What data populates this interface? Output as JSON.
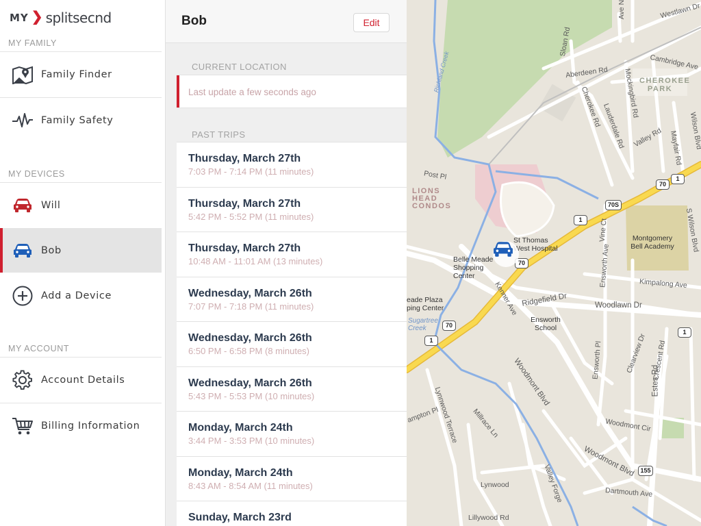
{
  "logo": {
    "my": "MY",
    "brand": "splitsecnd"
  },
  "sidebar": {
    "sections": {
      "family": "MY FAMILY",
      "devices": "MY DEVICES",
      "account": "MY ACCOUNT"
    },
    "family_items": [
      {
        "label": "Family Finder",
        "icon": "map-pin-icon"
      },
      {
        "label": "Family Safety",
        "icon": "heartbeat-icon"
      }
    ],
    "device_items": [
      {
        "label": "Will",
        "icon": "car-icon",
        "color": "#c0272d"
      },
      {
        "label": "Bob",
        "icon": "car-icon",
        "color": "#1f5fb8",
        "active": true
      },
      {
        "label": "Add a Device",
        "icon": "plus-circle-icon"
      }
    ],
    "account_items": [
      {
        "label": "Account Details",
        "icon": "gear-icon"
      },
      {
        "label": "Billing Information",
        "icon": "cart-icon"
      }
    ]
  },
  "panel": {
    "title": "Bob",
    "edit_label": "Edit",
    "current_location_label": "CURRENT LOCATION",
    "last_update": "Last update a few seconds ago",
    "past_trips_label": "PAST TRIPS",
    "trips": [
      {
        "day": "Thursday, March 27th",
        "time": "7:03 PM - 7:14 PM (11 minutes)"
      },
      {
        "day": "Thursday, March 27th",
        "time": "5:42 PM - 5:52 PM (11 minutes)"
      },
      {
        "day": "Thursday, March 27th",
        "time": "10:48 AM - 11:01 AM (13 minutes)"
      },
      {
        "day": "Wednesday, March 26th",
        "time": "7:07 PM - 7:18 PM (11 minutes)"
      },
      {
        "day": "Wednesday, March 26th",
        "time": "6:50 PM - 6:58 PM (8 minutes)"
      },
      {
        "day": "Wednesday, March 26th",
        "time": "5:43 PM - 5:53 PM (10 minutes)"
      },
      {
        "day": "Monday, March 24th",
        "time": "3:44 PM - 3:53 PM (10 minutes)"
      },
      {
        "day": "Monday, March 24th",
        "time": "8:43 AM - 8:54 AM (11 minutes)"
      },
      {
        "day": "Sunday, March 23rd",
        "time": ""
      }
    ]
  },
  "map": {
    "labels": {
      "westlawn": "Westlawn Dr",
      "cambridge": "Cambridge Ave",
      "aberdeen": "Aberdeen Rd",
      "cherokee_park": "CHEROKEE PARK",
      "richland_creek": "Richland Creek",
      "sloan": "Sloan Rd",
      "ave_n": "Ave N",
      "lions_head": "LIONS HEAD CONDOS",
      "post_pl": "Post Pl",
      "st_thomas": "St Thomas West Hospital",
      "belle_meade": "Belle Meade Shopping Center",
      "montgomery": "Montgomery Bell Academy",
      "kimpalong": "Kimpalong Ave",
      "woodlawn": "Woodlawn Dr",
      "ridgefield": "Ridgefield Dr",
      "ensworth_school": "Ensworth School",
      "kenner": "Kenner Ave",
      "meade_plaza": "eade Plaza ping Center",
      "sugartree": "Sugartree Creek",
      "woodmont_blvd": "Woodmont Blvd",
      "woodmont_cir": "Woodmont Cir",
      "lynnwood_terrace": "Lynnwood Terrace",
      "millrace": "Millrace Ln",
      "estes": "Estes Rd",
      "dartmouth": "Dartmouth Ave",
      "lynwood": "Lynwood",
      "lillywood": "Lillywood Rd",
      "valley_forge": "Valley Forge",
      "valley_rd": "Valley Rd",
      "mayfair": "Mayfair Rd",
      "wilson": "Wilson Blvd",
      "s_wilson": "S Wilson Blvd",
      "cherokee_rd": "Cherokee Rd",
      "mockingbird": "Mockingbird Rd",
      "lauderdale": "Lauderdale Rd",
      "vine": "Vine Ct",
      "ensworth_ave": "Ensworth Ave",
      "ensworth_pl": "Ensworth Pl",
      "clearview": "Clearview Dr",
      "crescent": "Crescent Rd",
      "hampton": "ampton Pl"
    },
    "shields": [
      "70",
      "1",
      "70S",
      "1",
      "70",
      "70",
      "1",
      "1",
      "155"
    ]
  }
}
